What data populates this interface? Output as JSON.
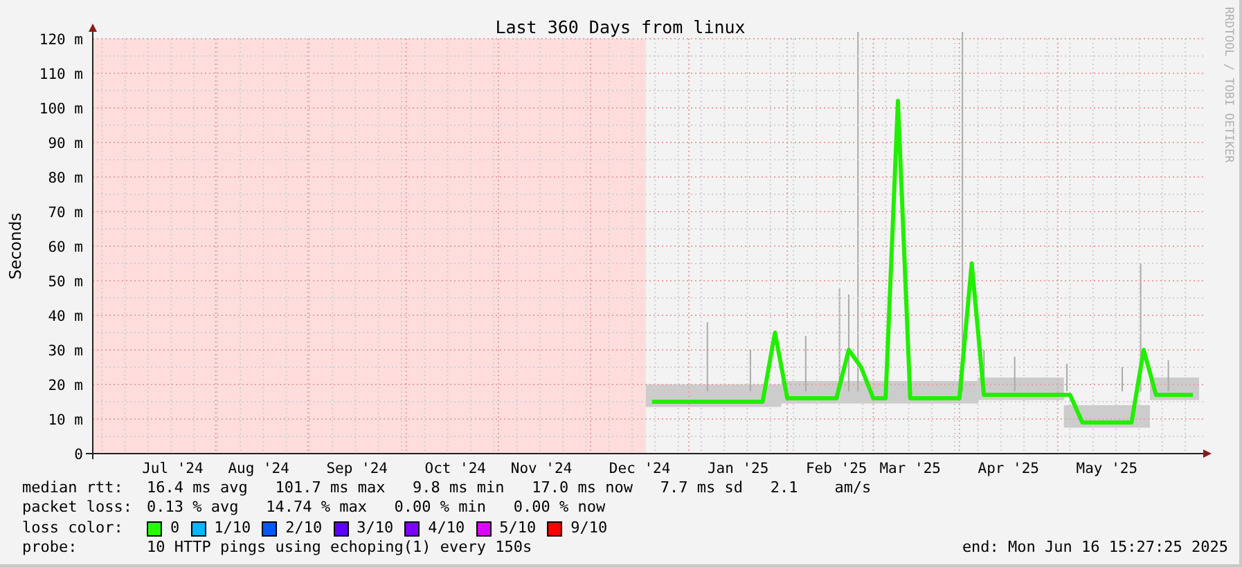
{
  "graph": {
    "watermark": "RRDTOOL / TOBI OETIKER",
    "chart_data": {
      "type": "line",
      "title": "Last 360 Days from linux",
      "ylabel": "Seconds",
      "ylim": [
        0,
        122
      ],
      "grid": true,
      "categories": [
        null,
        null,
        null,
        null,
        null,
        null,
        "Jul '24",
        null,
        null,
        null,
        null,
        null,
        null,
        "Aug '24",
        null,
        null,
        null,
        null,
        null,
        null,
        null,
        "Sep '24",
        null,
        null,
        null,
        null,
        null,
        null,
        null,
        "Oct '24",
        null,
        null,
        null,
        null,
        null,
        null,
        "Nov '24",
        null,
        null,
        null,
        null,
        null,
        null,
        null,
        "Dec '24",
        null,
        null,
        null,
        null,
        null,
        null,
        null,
        "Jan '25",
        null,
        null,
        null,
        null,
        null,
        null,
        null,
        "Feb '25",
        null,
        null,
        null,
        null,
        null,
        "Mar '25",
        null,
        null,
        null,
        null,
        null,
        null,
        null,
        "Apr '25",
        null,
        null,
        null,
        null,
        null,
        null,
        null,
        "May '25",
        null,
        null,
        null,
        null,
        null,
        null,
        null
      ],
      "yticks": [
        {
          "value": 0,
          "label": "0"
        },
        {
          "value": 10,
          "label": "10 m"
        },
        {
          "value": 20,
          "label": "20 m"
        },
        {
          "value": 30,
          "label": "30 m"
        },
        {
          "value": 40,
          "label": "40 m"
        },
        {
          "value": 50,
          "label": "50 m"
        },
        {
          "value": 60,
          "label": "60 m"
        },
        {
          "value": 70,
          "label": "70 m"
        },
        {
          "value": 80,
          "label": "80 m"
        },
        {
          "value": 90,
          "label": "90 m"
        },
        {
          "value": 100,
          "label": "100 m"
        },
        {
          "value": 110,
          "label": "110 m"
        },
        {
          "value": 120,
          "label": "120 m"
        }
      ],
      "series": [
        {
          "color": "#22ee00",
          "values": [
            null,
            null,
            null,
            null,
            null,
            null,
            null,
            null,
            null,
            null,
            null,
            null,
            null,
            null,
            null,
            null,
            null,
            null,
            null,
            null,
            null,
            null,
            null,
            null,
            null,
            null,
            null,
            null,
            null,
            null,
            null,
            null,
            null,
            null,
            null,
            null,
            null,
            null,
            null,
            null,
            null,
            null,
            null,
            null,
            null,
            15,
            15,
            15,
            15,
            15,
            15,
            15,
            15,
            15,
            15,
            35,
            16,
            16,
            16,
            16,
            16,
            30,
            25,
            16,
            16,
            102,
            16,
            16,
            16,
            16,
            16,
            55,
            17,
            17,
            17,
            17,
            17,
            17,
            17,
            17,
            9,
            9,
            9,
            9,
            9,
            30,
            17,
            17,
            17,
            17
          ]
        }
      ]
    }
  },
  "stats": [
    {
      "label": "median rtt:",
      "text": "16.4 ms avg   101.7 ms max   9.8 ms min   17.0 ms now   7.7 ms sd   2.1    am/s"
    },
    {
      "label": "packet loss:",
      "text": "0.13 % avg   14.74 % max   0.00 % min   0.00 % now"
    }
  ],
  "loss_color": {
    "label": "loss color:",
    "items": [
      {
        "label": "0",
        "color": "#26ff00"
      },
      {
        "label": "1/10",
        "color": "#00b8ff"
      },
      {
        "label": "2/10",
        "color": "#0059ff"
      },
      {
        "label": "3/10",
        "color": "#5e00ff"
      },
      {
        "label": "4/10",
        "color": "#7e00ff"
      },
      {
        "label": "5/10",
        "color": "#dd00ff"
      },
      {
        "label": "9/10",
        "color": "#ff0000"
      }
    ]
  },
  "probe": {
    "label": "probe:",
    "text": "10 HTTP pings using echoping(1) every 150s",
    "end": "end: Mon Jun 16 15:27:25 2025"
  }
}
